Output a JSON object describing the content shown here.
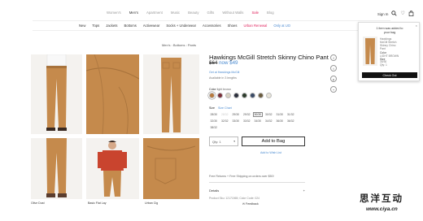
{
  "topnav": {
    "links": [
      "Women's",
      "Men's",
      "Apartment",
      "Music",
      "Beauty",
      "Gifts",
      "Without Walls",
      "Sale",
      "Blog"
    ],
    "sign_in": "Sign In"
  },
  "subnav": {
    "links": [
      "New",
      "Tops",
      "Jackets",
      "Bottoms",
      "Activewear",
      "Socks + Underwear",
      "Accessories",
      "Shoes",
      "Urban Renewal",
      "Only at UO"
    ]
  },
  "breadcrumb": "Men's : Bottoms : Pants",
  "gallery": {
    "captions": [
      "Olive Dust",
      "Basic Flat Lay",
      "Urban Cig"
    ]
  },
  "product": {
    "title": "Hawkings McGill Stretch Skinny Chino Pant",
    "old_price": "$64",
    "new_price": "now $49",
    "link1": "Get at Hawkings McGill",
    "availability": "Available in 3 lengths",
    "color_label": "Color",
    "color_value": "light brown",
    "swatch_colors": [
      "#b87a3d",
      "#7a2f3a",
      "#d8d2c2",
      "#2b2f3c",
      "#2d3b2c",
      "#3a4a66",
      "#6a5b3e",
      "#e8e4da"
    ],
    "size_label": "Size",
    "size_chart": "Size Chart",
    "sizes": [
      "28/30",
      "28/32",
      "29/30",
      "29/32",
      "30/30",
      "30/32",
      "31/30",
      "31/32",
      "32/30",
      "32/32",
      "33/30",
      "33/32",
      "34/30",
      "34/32",
      "36/30",
      "36/32",
      "38/32"
    ],
    "size_selected": "30/30",
    "qty_label": "Qty: 1",
    "add_to_bag": "Add to Bag",
    "wishlist": "Add to Wish List",
    "shipping": "Free Returns + Free Shipping on orders over $50!",
    "details_label": "Details",
    "details_toggle": "+",
    "meta": "Product Sku: 12171565; Color Code: 024",
    "feedback": "Feedback"
  },
  "social": [
    "f",
    "t",
    "p",
    "+"
  ],
  "bag_popup": {
    "close": "×",
    "heading_line1": "1 item was added to",
    "heading_line2": "your bag",
    "item_name_lines": [
      "Hawkings",
      "McGill Stretch",
      "Skinny Chino",
      "Pant"
    ],
    "color_label": "Color",
    "color_value": "LIGHT BROWN",
    "size_label": "Size",
    "size_value": "30/30",
    "qty": "Qty: 1",
    "button": "Check Out"
  },
  "watermark": {
    "text": "思洋互动",
    "url": "www.ciya.cn"
  },
  "colors": {
    "accent_blue": "#4a8ad0",
    "sale_red": "#e0245e",
    "pant_tan": "#c58a4c"
  },
  "icons": [
    "search-icon",
    "heart-icon",
    "bag-icon"
  ]
}
